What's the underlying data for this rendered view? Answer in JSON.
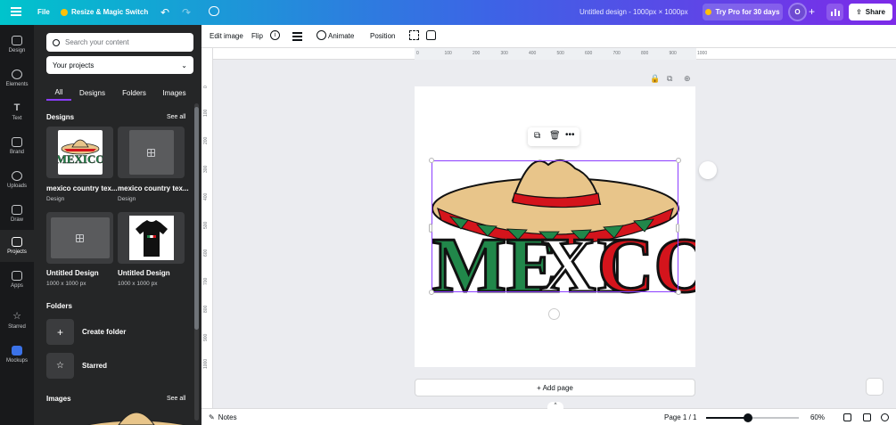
{
  "topbar": {
    "file_label": "File",
    "resize_label": "Resize & Magic Switch",
    "doc_title": "Untitled design - 1000px × 1000px",
    "pro_label": "Try Pro for 30 days",
    "avatar_letter": "O",
    "share_label": "Share"
  },
  "rail": {
    "items": [
      {
        "label": "Design",
        "icon": "design-icon"
      },
      {
        "label": "Elements",
        "icon": "elements-icon"
      },
      {
        "label": "Text",
        "icon": "text-icon"
      },
      {
        "label": "Brand",
        "icon": "brand-icon"
      },
      {
        "label": "Uploads",
        "icon": "uploads-icon"
      },
      {
        "label": "Draw",
        "icon": "draw-icon"
      },
      {
        "label": "Projects",
        "icon": "projects-icon"
      },
      {
        "label": "Apps",
        "icon": "apps-icon"
      },
      {
        "label": "Starred",
        "icon": "star-icon"
      },
      {
        "label": "Mockups",
        "icon": "mockups-icon"
      }
    ],
    "active": "Projects"
  },
  "panel": {
    "search_placeholder": "Search your content",
    "select_value": "Your projects",
    "tabs": [
      "All",
      "Designs",
      "Folders",
      "Images"
    ],
    "designs_title": "Designs",
    "see_all": "See all",
    "designs": [
      {
        "name": "mexico country tex...",
        "sub": "Design"
      },
      {
        "name": "mexico country tex...",
        "sub": "Design"
      },
      {
        "name": "Untitled Design",
        "sub": "1000 x 1000 px"
      },
      {
        "name": "Untitled Design",
        "sub": "1000 x 1000 px"
      }
    ],
    "folders_title": "Folders",
    "create_folder": "Create folder",
    "starred": "Starred",
    "images_title": "Images"
  },
  "toolbar": {
    "edit_image": "Edit image",
    "flip": "Flip",
    "animate": "Animate",
    "position": "Position"
  },
  "ruler": {
    "top": [
      "0",
      "100",
      "200",
      "300",
      "400",
      "500",
      "600",
      "700",
      "800",
      "900",
      "1000"
    ],
    "left": [
      "0",
      "100",
      "200",
      "300",
      "400",
      "500",
      "600",
      "700",
      "800",
      "900",
      "1000"
    ]
  },
  "canvas": {
    "artwork_word": "MEXICO",
    "add_page": "+ Add page"
  },
  "bottombar": {
    "notes": "Notes",
    "page_info": "Page 1 / 1",
    "zoom": "60%",
    "zoom_fraction": 0.45
  },
  "colors": {
    "accent": "#8b3dff",
    "mexico_green": "#21874a",
    "mexico_red": "#d4141c",
    "sombrero": "#e8c58a"
  }
}
